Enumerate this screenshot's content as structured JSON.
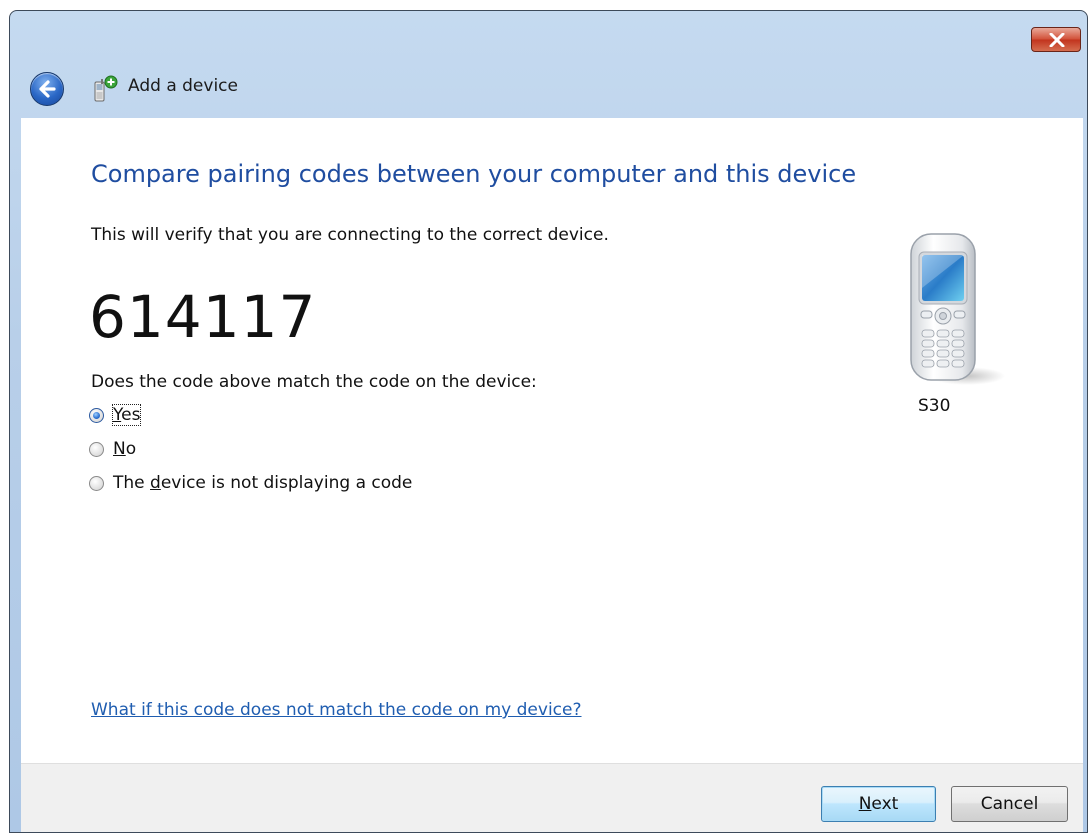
{
  "window": {
    "title": "Add a device",
    "close_icon": "close-icon",
    "back_icon": "back-arrow-icon"
  },
  "main": {
    "heading": "Compare pairing codes between your computer and this device",
    "description": "This will verify that you are connecting to the correct device.",
    "pairing_code": "614117",
    "question": "Does the code above match the code on the device:",
    "options": [
      {
        "pre": "",
        "accel": "Y",
        "post": "es",
        "checked": true
      },
      {
        "pre": "",
        "accel": "N",
        "post": "o",
        "checked": false
      },
      {
        "pre": "The ",
        "accel": "d",
        "post": "evice is not displaying a code",
        "checked": false
      }
    ],
    "device_name": "S30",
    "help_link": "What if this code does not match the code on my device?"
  },
  "footer": {
    "next": {
      "accel": "N",
      "rest": "ext"
    },
    "cancel_label": "Cancel"
  },
  "colors": {
    "heading": "#1f4da0",
    "link": "#1f5db0",
    "titlebar": "#b8cfe9",
    "close_button": "#c2341e"
  }
}
